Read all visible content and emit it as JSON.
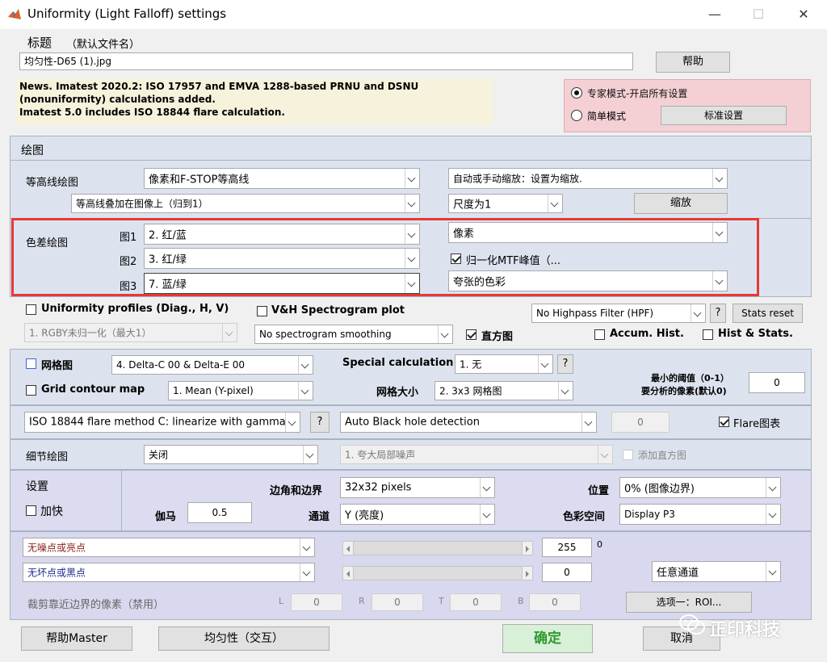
{
  "window": {
    "title": "Uniformity (Light Falloff) settings",
    "minimize": "—",
    "maximize": "☐",
    "close": "✕"
  },
  "title_section": {
    "label": "标题",
    "hint": "（默认文件名）",
    "filename": "均匀性-D65 (1).jpg",
    "help_button": "帮助"
  },
  "news": {
    "line1": "News. Imatest 2020.2:  ISO 17957 and EMVA 1288-based PRNU and DSNU",
    "line2": "(nonuniformity) calculations added.",
    "line3": "Imatest 5.0 includes ISO 18844 flare calculation."
  },
  "mode": {
    "expert": "专家模式-开启所有设置",
    "simple": "简单模式",
    "standard_button": "标准设置"
  },
  "plots": {
    "header": "绘图",
    "contour_label": "等高线绘图",
    "contour_type": "像素和F-STOP等高线",
    "contour_overlay": "等高线叠加在图像上（归到1）",
    "zoom_mode": "自动或手动缩放：设置为缩放.",
    "scale": "尺度为1",
    "zoom_button": "缩放"
  },
  "chroma": {
    "label": "色差绘图",
    "fig1_label": "图1",
    "fig1_value": "2.  红/蓝",
    "fig2_label": "图2",
    "fig2_value": "3.  红/绿",
    "fig3_label": "图3",
    "fig3_value": "7.  蓝/绿",
    "unit": "像素",
    "normalize_mtf": "归一化MTF峰值（...",
    "exaggerated": "夸张的色彩"
  },
  "profiles": {
    "uniformity_profiles": "Uniformity profiles (Diag., H, V)",
    "rgby_option": "1. RGBY未归一化（最大1）",
    "vh_spectrogram": "V&H Spectrogram plot",
    "smoothing": "No  spectrogram smoothing",
    "histogram": "直方图",
    "hpf": "No Highpass Filter (HPF)",
    "help_q": "?",
    "stats_reset": "Stats reset",
    "accum_hist": "Accum. Hist.",
    "hist_stats": "Hist & Stats."
  },
  "grid": {
    "grid_map": "网格图",
    "delta_option": "4.  Delta-C 00  &  Delta-E 00",
    "special_label": "Special calculation",
    "special_value": "1. 无",
    "help_q": "?",
    "contour_map": "Grid contour map",
    "mean_option": "1.  Mean (Y-pixel)",
    "grid_size_label": "网格大小",
    "grid_size_value": "2.   3x3 网格图",
    "min_threshold_line1": "最小的阈值（0-1）",
    "min_threshold_line2": "要分析的像素(默认0)",
    "min_threshold_value": "0"
  },
  "flare": {
    "method": "ISO 18844 flare method C: linearize with gamma",
    "help_q": "?",
    "black_hole": "Auto Black hole detection",
    "value": "0",
    "flare_plot": "Flare图表"
  },
  "detail": {
    "label": "细节绘图",
    "state": "关闭",
    "noise_option": "1.   夸大局部噪声",
    "add_hist": "添加直方图"
  },
  "settings": {
    "label": "设置",
    "speedup": "加快",
    "gamma_label": "伽马",
    "gamma_value": "0.5",
    "corner_label": "边角和边界",
    "corner_value": "32x32 pixels",
    "channel_label": "通道",
    "channel_value": "Y (亮度)",
    "position_label": "位置",
    "position_value": "0% (图像边界)",
    "colorspace_label": "色彩空间",
    "colorspace_value": "Display P3"
  },
  "pixels": {
    "hot_option": "无噪点或亮点",
    "hot_value": "255",
    "hot_extra": "0",
    "dead_option": "无坏点或黑点",
    "dead_value": "0",
    "any_channel": "任意通道",
    "crop_label": "裁剪靠近边界的像素（禁用）",
    "L": "L",
    "L_val": "0",
    "R": "R",
    "R_val": "0",
    "T": "T",
    "T_val": "0",
    "B": "B",
    "B_val": "0",
    "options_button": "选项一：ROI..."
  },
  "footer": {
    "help_master": "帮助Master",
    "uniformity_interactive": "均匀性（交互）",
    "ok": "确定",
    "cancel": "取消",
    "watermark": "正印科技"
  },
  "colors": {
    "panel_bg": "#dde3ee",
    "settings_bg": "#dcdcf0",
    "pixels_bg": "#d8d8ee",
    "news_bg": "#f6f2dc",
    "mode_bg": "#f4d0d4",
    "highlight_border": "#e53935",
    "ok_bg": "#d8f0d8",
    "ok_text": "#2e9a2e"
  }
}
